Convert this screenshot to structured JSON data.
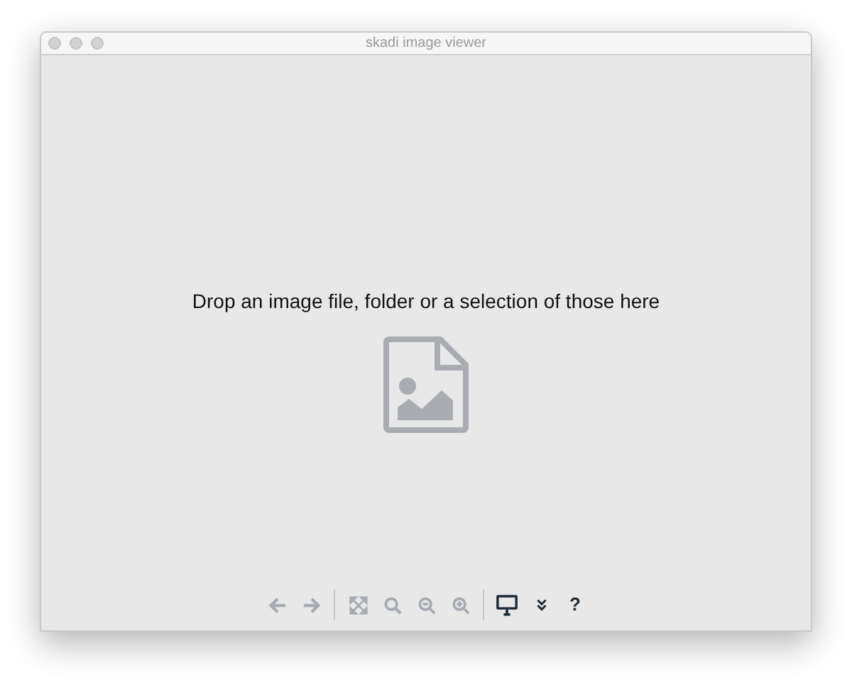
{
  "window": {
    "title": "skadi image viewer"
  },
  "drop_zone": {
    "message": "Drop an image file, folder or a selection of those here"
  },
  "toolbar": {
    "groups": [
      [
        {
          "kind": "back",
          "disabled": true
        },
        {
          "kind": "forward",
          "disabled": true
        }
      ],
      [
        {
          "kind": "fit",
          "disabled": true
        },
        {
          "kind": "zoom",
          "disabled": true
        },
        {
          "kind": "zoom-out",
          "disabled": true
        },
        {
          "kind": "zoom-in",
          "disabled": true
        }
      ],
      [
        {
          "kind": "monitor",
          "disabled": false
        },
        {
          "kind": "more",
          "disabled": false
        },
        {
          "kind": "text",
          "label": "?",
          "disabled": false
        }
      ]
    ]
  }
}
